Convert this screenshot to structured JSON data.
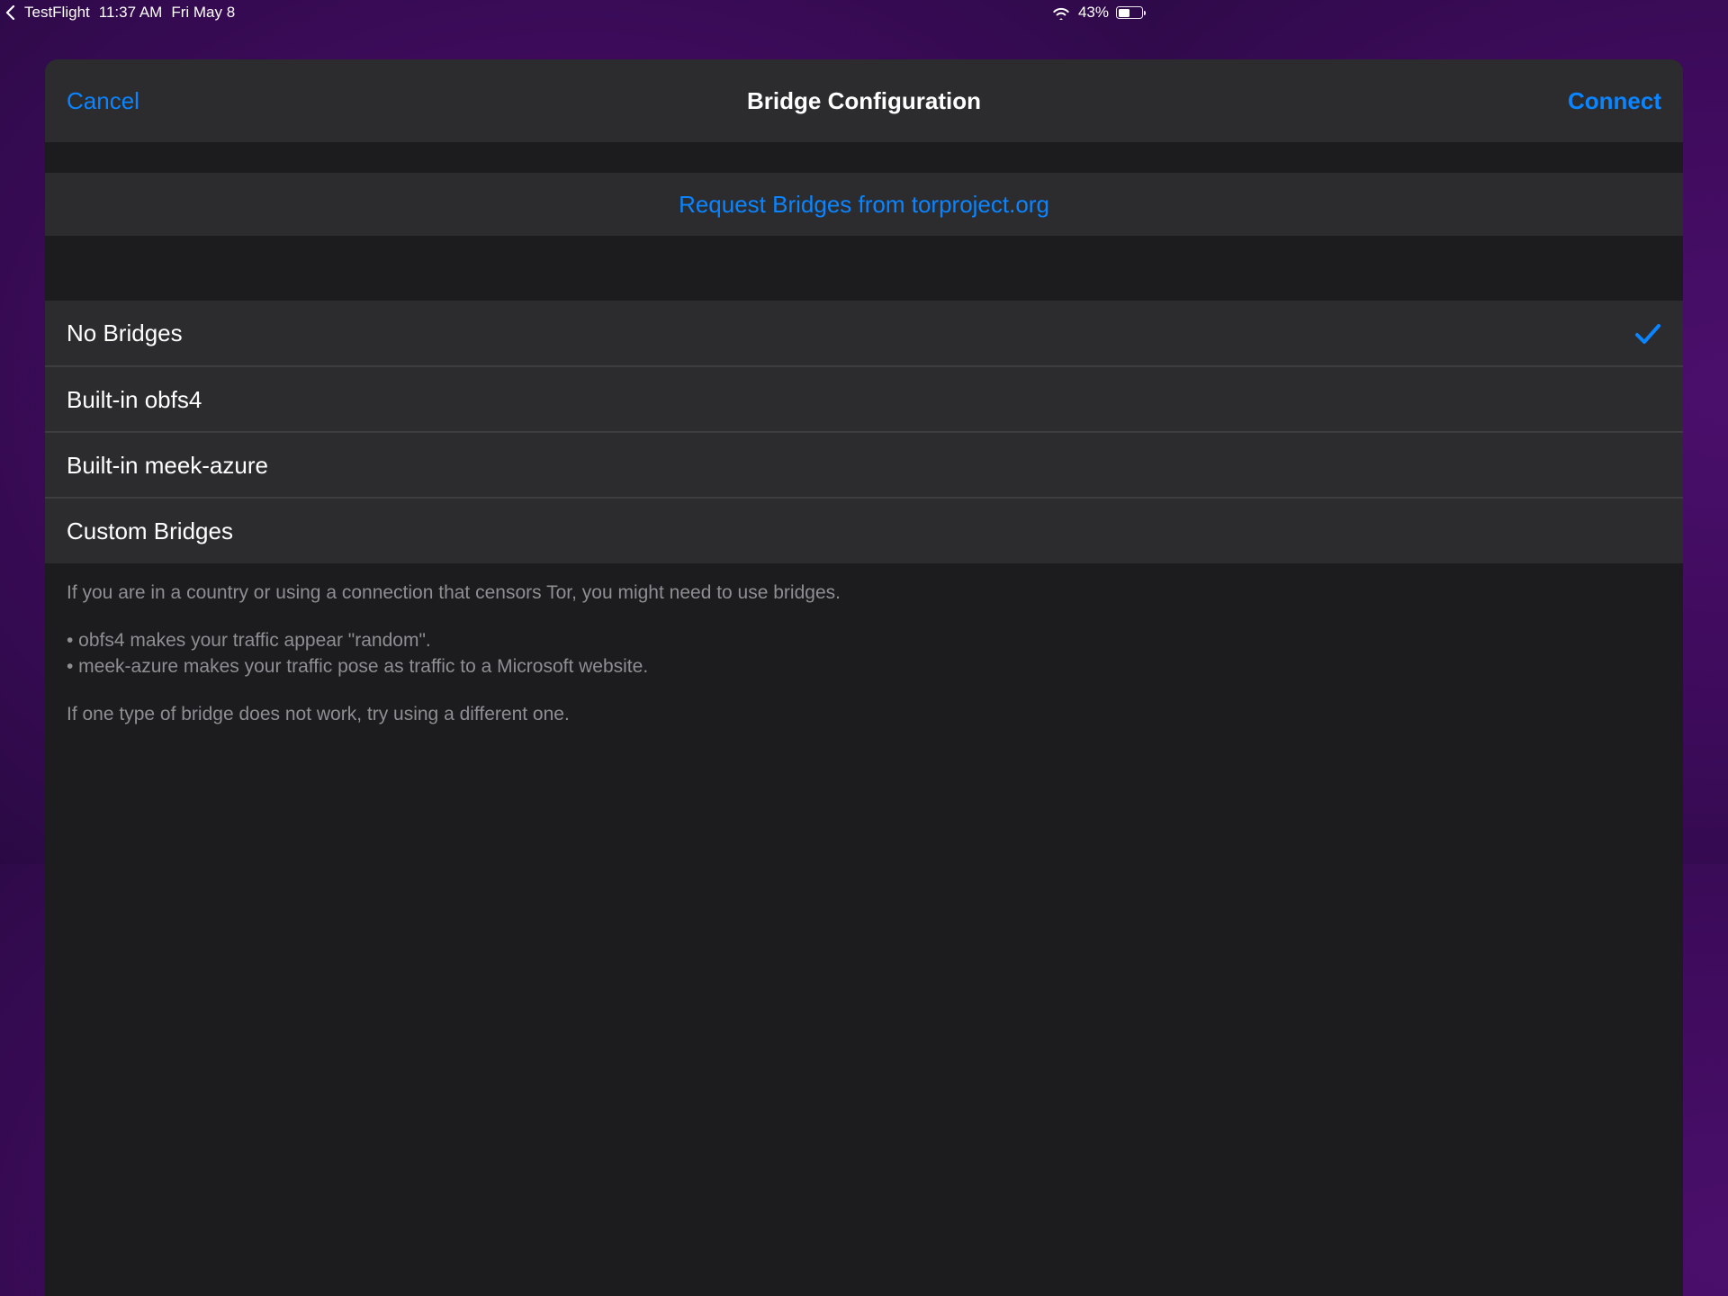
{
  "statusbar": {
    "back_app": "TestFlight",
    "time": "11:37 AM",
    "date": "Fri May 8",
    "battery_percent": "43%"
  },
  "navbar": {
    "cancel": "Cancel",
    "title": "Bridge Configuration",
    "connect": "Connect"
  },
  "request_link": "Request Bridges from torproject.org",
  "options": {
    "0": {
      "label": "No Bridges",
      "selected": true
    },
    "1": {
      "label": "Built-in obfs4",
      "selected": false
    },
    "2": {
      "label": "Built-in meek-azure",
      "selected": false
    },
    "3": {
      "label": "Custom Bridges",
      "selected": false
    }
  },
  "footer": {
    "p1": "If you are in a country or using a connection that censors Tor, you might need to use bridges.",
    "b1": "• obfs4 makes your traffic appear \"random\".",
    "b2": "• meek-azure makes your traffic pose as traffic to a Microsoft website.",
    "p2": "If one type of bridge does not work, try using a different one."
  },
  "colors": {
    "accent": "#0a84ff",
    "bg_sheet": "#1c1c1e",
    "bg_row": "#2c2c2e",
    "text_secondary": "#8e8e93"
  }
}
